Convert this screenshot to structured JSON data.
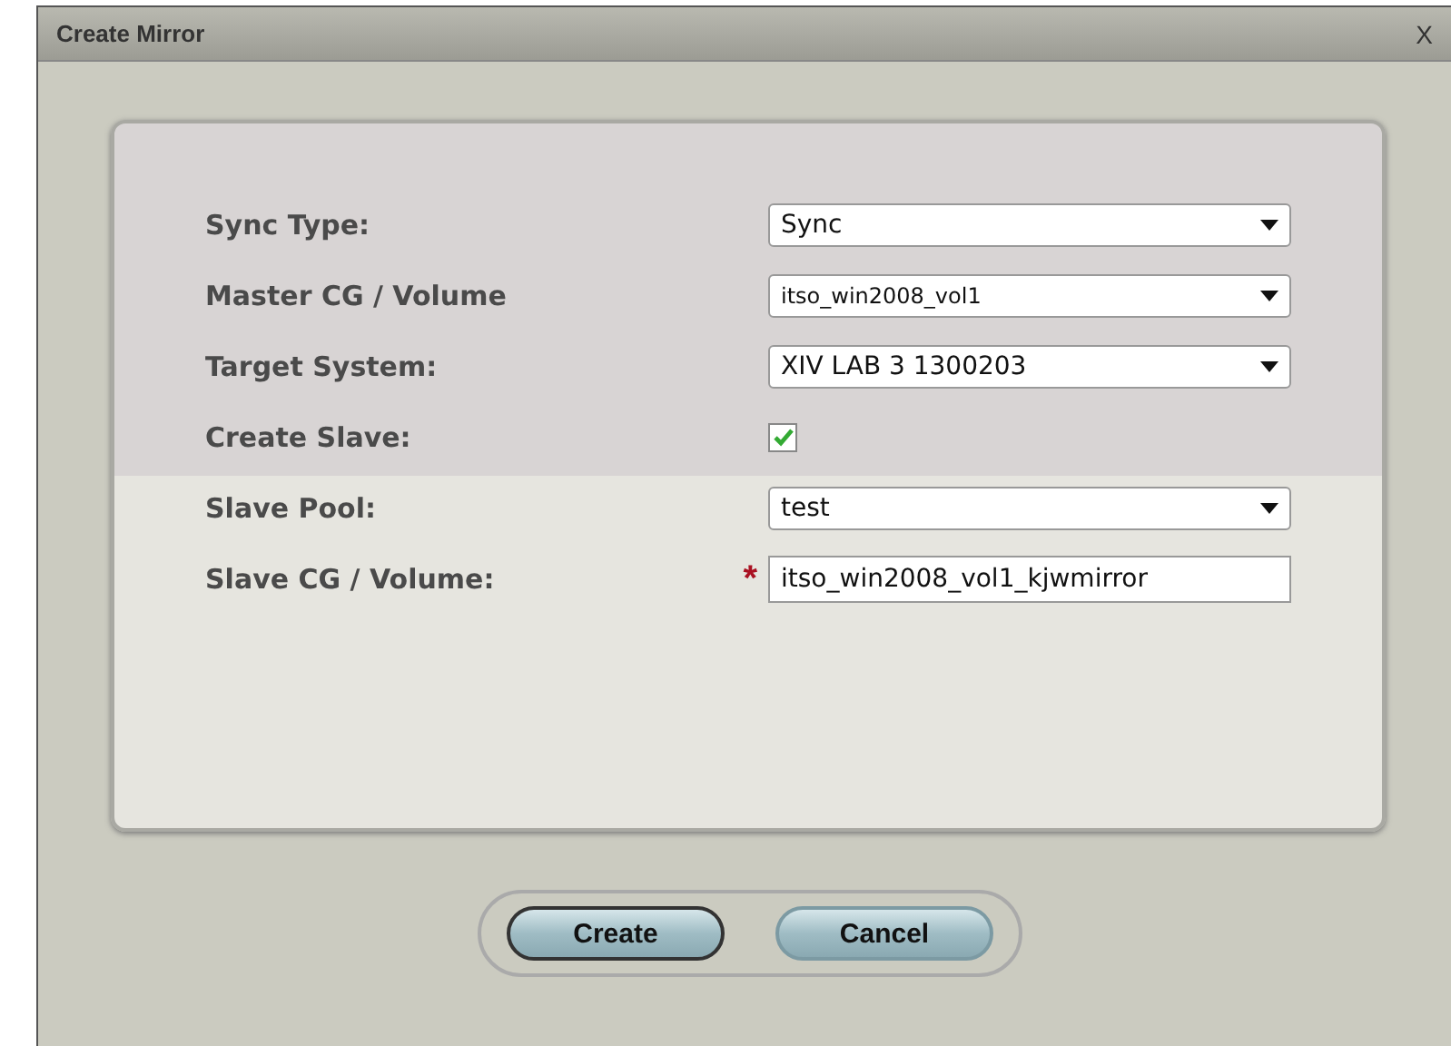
{
  "window": {
    "title": "Create Mirror",
    "close": "X"
  },
  "fields": [
    {
      "label": "Sync Type:",
      "kind": "select",
      "value": "Sync"
    },
    {
      "label": "Master  CG / Volume",
      "kind": "select",
      "value": "itso_win2008_vol1"
    },
    {
      "label": "Target System:",
      "kind": "select",
      "value": "XIV LAB 3 1300203"
    },
    {
      "label": "Create Slave:",
      "kind": "checkbox",
      "checked": true
    },
    {
      "label": "Slave Pool:",
      "kind": "select",
      "value": "test"
    },
    {
      "label": "Slave CG / Volume:",
      "kind": "text",
      "value": "itso_win2008_vol1_kjwmirror",
      "marker": "*"
    }
  ],
  "buttons": [
    {
      "label": "Create",
      "default": true
    },
    {
      "label": "Cancel",
      "default": false
    }
  ]
}
